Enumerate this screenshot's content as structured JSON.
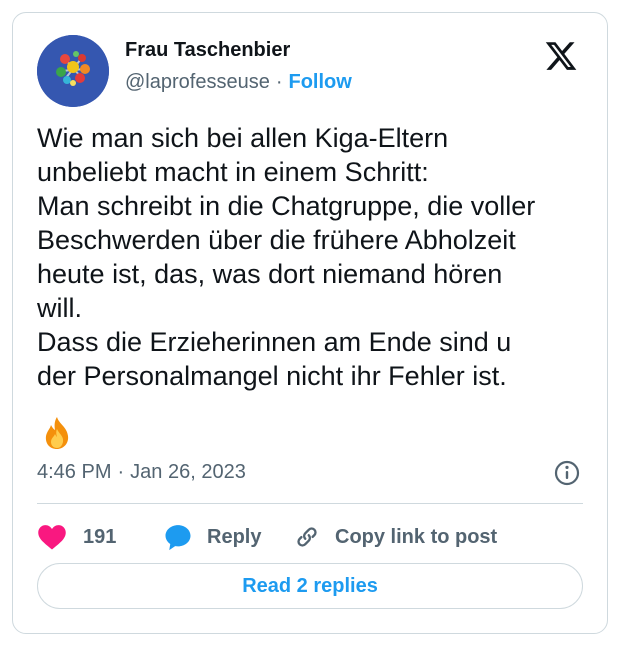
{
  "author": {
    "name": "Frau Taschenbier",
    "handle": "@laprofesseuse",
    "separator": "·",
    "follow_label": "Follow"
  },
  "tweet": {
    "lines": [
      "Wie man sich bei allen Kiga-Eltern",
      "unbeliebt macht in einem Schritt:",
      "Man schreibt in die Chatgruppe, die voller",
      "Beschwerden über die frühere Abholzeit",
      "heute ist, das, was dort niemand hören",
      "will.",
      "Dass die Erzieherinnen am Ende sind u",
      "der Personalmangel nicht ihr Fehler ist."
    ],
    "emoji": "fire-emoji"
  },
  "meta": {
    "time": "4:46 PM",
    "separator": "·",
    "date": "Jan 26, 2023"
  },
  "actions": {
    "like_count": "191",
    "reply_label": "Reply",
    "copy_label": "Copy link to post"
  },
  "replies_button": "Read 2 replies",
  "colors": {
    "accent": "#1d9bf0",
    "like": "#f91880",
    "text": "#0f1419",
    "muted": "#536471",
    "border": "#cfd9de"
  },
  "icons": {
    "brand": "x-logo-icon",
    "info": "info-icon",
    "like": "heart-icon",
    "reply": "speech-bubble-icon",
    "copy": "link-icon"
  }
}
